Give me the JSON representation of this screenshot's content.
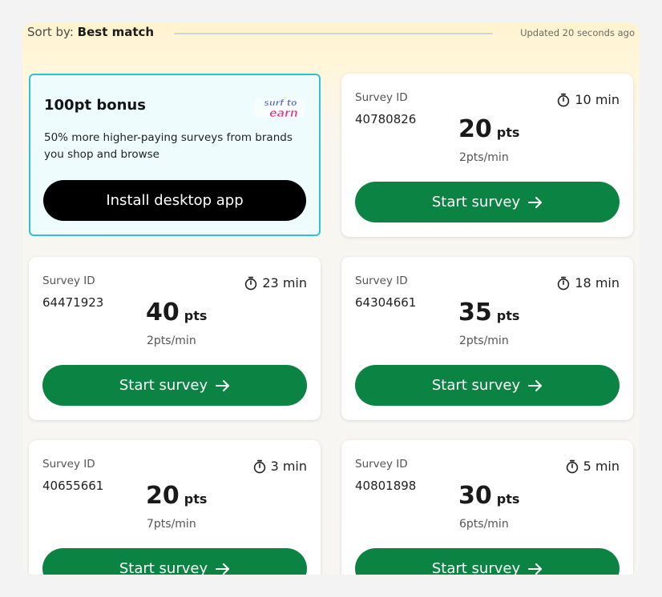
{
  "sort": {
    "prefix": "Sort by: ",
    "value": "Best match",
    "updated": "Updated 20 seconds ago"
  },
  "promo": {
    "title": "100pt bonus",
    "logo_text_line1": "surf to",
    "logo_text_line2": "earn",
    "description": "50% more higher-paying surveys from brands you shop and browse",
    "button_label": "Install desktop app"
  },
  "labels": {
    "survey_id": "Survey ID",
    "pts_unit": "pts",
    "start_button": "Start survey"
  },
  "surveys": [
    {
      "id": "40780826",
      "duration": "10 min",
      "points": "20",
      "rate": "2pts/min"
    },
    {
      "id": "64471923",
      "duration": "23 min",
      "points": "40",
      "rate": "2pts/min"
    },
    {
      "id": "64304661",
      "duration": "18 min",
      "points": "35",
      "rate": "2pts/min"
    },
    {
      "id": "40655661",
      "duration": "3 min",
      "points": "20",
      "rate": "7pts/min"
    },
    {
      "id": "40801898",
      "duration": "5 min",
      "points": "30",
      "rate": "6pts/min"
    }
  ],
  "colors": {
    "primary_green": "#0b8443",
    "promo_border": "#2cc3d4",
    "promo_bg": "#eefcfd",
    "install_button": "#000000"
  },
  "icons": {
    "duration": "stopwatch-icon",
    "start": "arrow-right-icon"
  }
}
